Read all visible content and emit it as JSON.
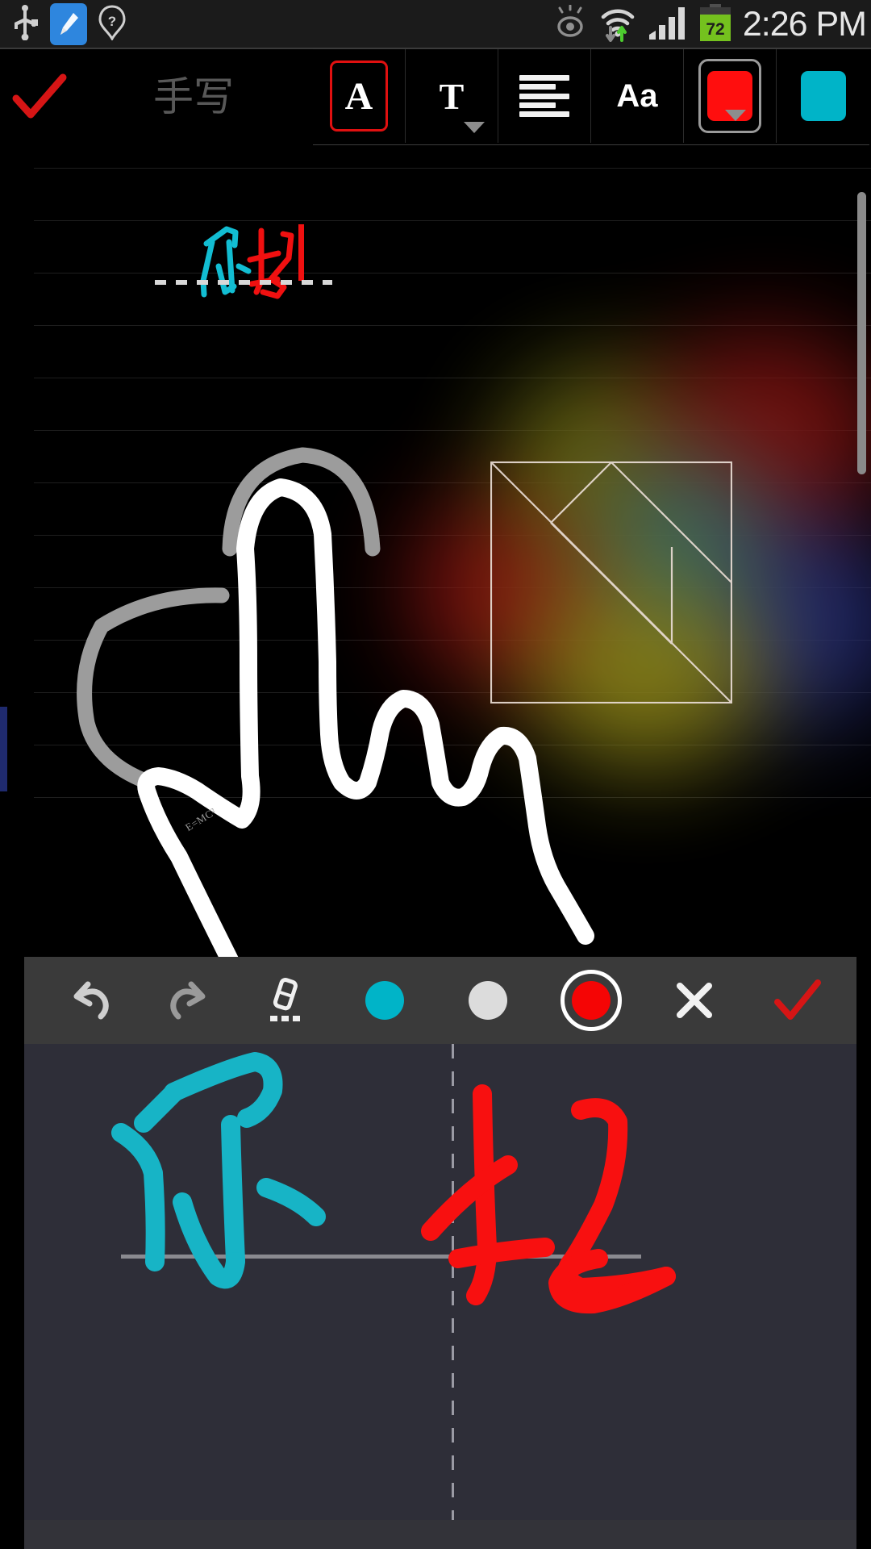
{
  "statusbar": {
    "icons": [
      "usb-icon",
      "cleaner-icon",
      "unknown-network-icon",
      "eye-care-icon",
      "wifi-icon",
      "signal-bars-icon",
      "battery-icon"
    ],
    "battery_level": "72",
    "clock": "2:26 PM"
  },
  "toolbar": {
    "confirm_label": "✓",
    "title": "手写",
    "buttons": [
      {
        "name": "text-style-button",
        "glyph": "A",
        "selected": true
      },
      {
        "name": "font-family-button",
        "glyph": "T",
        "selected": false,
        "has_dropdown": true
      },
      {
        "name": "text-align-button",
        "glyph": "align",
        "selected": false
      },
      {
        "name": "font-size-button",
        "glyph": "Aa",
        "selected": false
      },
      {
        "name": "text-color-button",
        "glyph": "swatch",
        "selected": true,
        "color": "#FF0E0E",
        "has_dropdown": true
      },
      {
        "name": "highlight-color-button",
        "glyph": "swatch",
        "selected": false,
        "color": "#00B4C8"
      }
    ],
    "collapse_label": "⌄"
  },
  "canvas": {
    "note_text_teal": "你",
    "note_text_red": "好",
    "cursor": "|",
    "tiny_annotation": "E=MC²",
    "shape_name": "tangram-square",
    "rule_count": 13,
    "rule_spacing": 65,
    "left_marker_color": "#1F2A6E",
    "teal": "#00BCD4",
    "red": "#F01010",
    "white_ink": "#FFFFFF",
    "gray_ink": "#9C9C9C"
  },
  "handwriting_panel": {
    "tools": [
      {
        "name": "undo-button",
        "glyph": "↶"
      },
      {
        "name": "redo-button",
        "glyph": "↷"
      },
      {
        "name": "eraser-button",
        "glyph": "eraser"
      },
      {
        "name": "color-teal-button",
        "glyph": "dot",
        "color": "#00B4C8",
        "selected": false
      },
      {
        "name": "color-white-button",
        "glyph": "dot",
        "color": "#DCDCDC",
        "selected": false
      },
      {
        "name": "color-red-button",
        "glyph": "dot",
        "color": "#F50505",
        "selected": true
      },
      {
        "name": "close-button",
        "glyph": "✕"
      },
      {
        "name": "accept-button",
        "glyph": "✓"
      }
    ],
    "ink_left": "你",
    "ink_right": "好",
    "ink_left_color": "#17B4C6",
    "ink_right_color": "#F81010",
    "board_bg": "#2E2E38"
  }
}
